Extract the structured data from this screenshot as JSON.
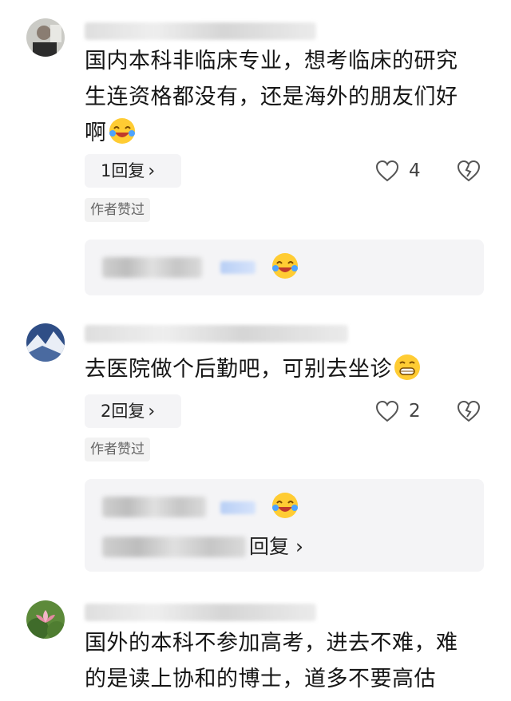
{
  "comments": [
    {
      "text_lines": [
        "国内本科非临床专业，想考临床的研究",
        "生连资格都没有，还是海外的朋友们好",
        "啊"
      ],
      "reply_label": "1回复",
      "like_count": "4",
      "author_liked": "作者赞过",
      "avatar_icon": "user-avatar-icon",
      "emoji": "laughing-crying-emoji"
    },
    {
      "text_lines": [
        "去医院做个后勤吧，可别去坐诊"
      ],
      "reply_label": "2回复",
      "like_count": "2",
      "author_liked": "作者赞过",
      "avatar_icon": "user-avatar-icon",
      "emoji": "grinning-emoji",
      "sub_more": "回复"
    },
    {
      "text_lines": [
        "国外的本科不参加高考，进去不难，难",
        "的是读上协和的博士，道多不要高估"
      ],
      "avatar_icon": "lotus-avatar-icon"
    }
  ],
  "colors": {
    "background": "#ffffff",
    "text": "#161616",
    "pill": "#f4f4f6",
    "muted": "#666666"
  }
}
